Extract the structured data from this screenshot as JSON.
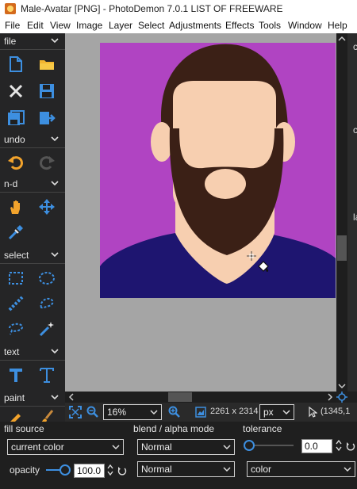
{
  "window": {
    "title": "Male-Avatar [PNG]  -  PhotoDemon 7.0.1  LIST OF FREEWARE",
    "icon": "photodemon-icon"
  },
  "menu": [
    "File",
    "Edit",
    "View",
    "Image",
    "Layer",
    "Select",
    "Adjustments",
    "Effects",
    "Tools",
    "Window",
    "Help"
  ],
  "toolbox": {
    "sections": [
      {
        "label": "file",
        "tools": [
          "new-file-icon",
          "open-folder-icon",
          "close-icon",
          "save-icon",
          "save-all-icon",
          "export-icon"
        ]
      },
      {
        "label": "undo",
        "tools": [
          "undo-icon",
          "redo-icon"
        ]
      },
      {
        "label": "n-d",
        "tools": [
          "hand-icon",
          "move-icon",
          "color-picker-icon"
        ]
      },
      {
        "label": "select",
        "tools": [
          "rect-select-icon",
          "ellipse-select-icon",
          "line-select-icon",
          "lasso-select-icon",
          "polygon-lasso-icon",
          "magic-wand-icon"
        ]
      },
      {
        "label": "text",
        "tools": [
          "text-icon",
          "typography-icon"
        ]
      },
      {
        "label": "paint",
        "tools": [
          "pencil-icon",
          "brush-icon"
        ]
      }
    ]
  },
  "canvas": {
    "colors": {
      "background": "#b044c2",
      "hair": "#3b2016",
      "skin": "#f7cfb0",
      "shirt": "#1e1570"
    }
  },
  "right_panel": {
    "labels": [
      "c",
      "c",
      "la"
    ]
  },
  "statusbar": {
    "zoom": "16%",
    "image_size": "2261 x 2314",
    "unit": "px",
    "cursor_pos": "(1345,1"
  },
  "options": {
    "fill_source_label": "fill source",
    "fill_source_value": "current color",
    "blend_label": "blend / alpha mode",
    "blend_value": "Normal",
    "alpha_value": "Normal",
    "tolerance_label": "tolerance",
    "tolerance_value": "0.0",
    "tolerance_fraction": 0.0,
    "opacity_label": "opacity",
    "opacity_value": "100.0",
    "opacity_fraction": 1.0,
    "compare_value": "color"
  },
  "accent": "#3d8fe0"
}
